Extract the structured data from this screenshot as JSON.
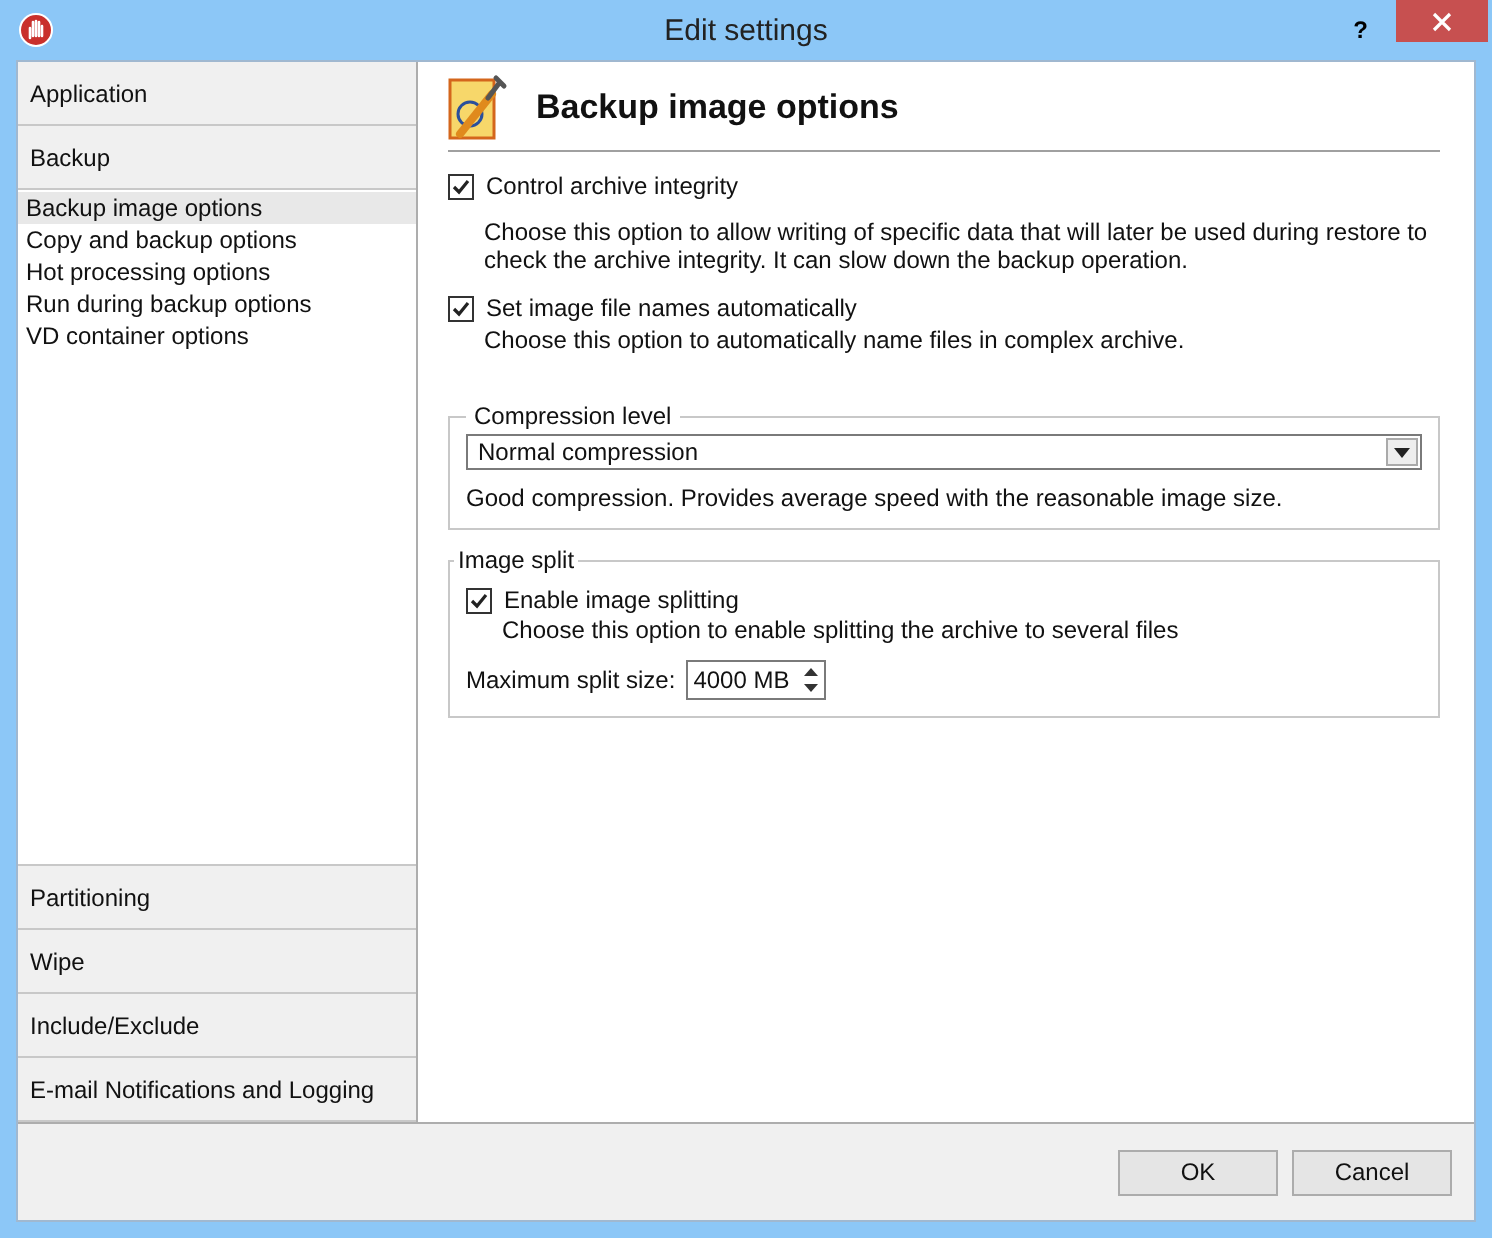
{
  "window": {
    "title": "Edit settings",
    "help": "?"
  },
  "sidebar": {
    "groups": [
      {
        "label": "Application"
      },
      {
        "label": "Backup",
        "expanded": true,
        "children": [
          {
            "label": "Backup image options",
            "selected": true
          },
          {
            "label": "Copy and backup options",
            "selected": false
          },
          {
            "label": "Hot processing options",
            "selected": false
          },
          {
            "label": "Run during backup options",
            "selected": false
          },
          {
            "label": "VD container options",
            "selected": false
          }
        ]
      },
      {
        "label": "Partitioning"
      },
      {
        "label": "Wipe"
      },
      {
        "label": "Include/Exclude"
      },
      {
        "label": "E-mail Notifications and Logging"
      }
    ]
  },
  "page": {
    "title": "Backup image options",
    "options": [
      {
        "label": "Control archive integrity",
        "checked": true,
        "description": "Choose this option to allow writing of specific data that will later be used during restore to check the archive integrity. It can slow down the backup operation."
      },
      {
        "label": "Set image file names automatically",
        "checked": true,
        "description": "Choose this option to automatically name files in complex archive."
      }
    ],
    "compression": {
      "legend": "Compression level",
      "value": "Normal compression",
      "description": "Good compression. Provides average speed with the reasonable image size."
    },
    "split": {
      "legend": "Image split",
      "label": "Enable image splitting",
      "checked": true,
      "description": "Choose this option to enable splitting the archive to several files",
      "size_label": "Maximum split size:",
      "size_value": "4000 MB"
    }
  },
  "buttons": [
    "OK",
    "Cancel"
  ]
}
